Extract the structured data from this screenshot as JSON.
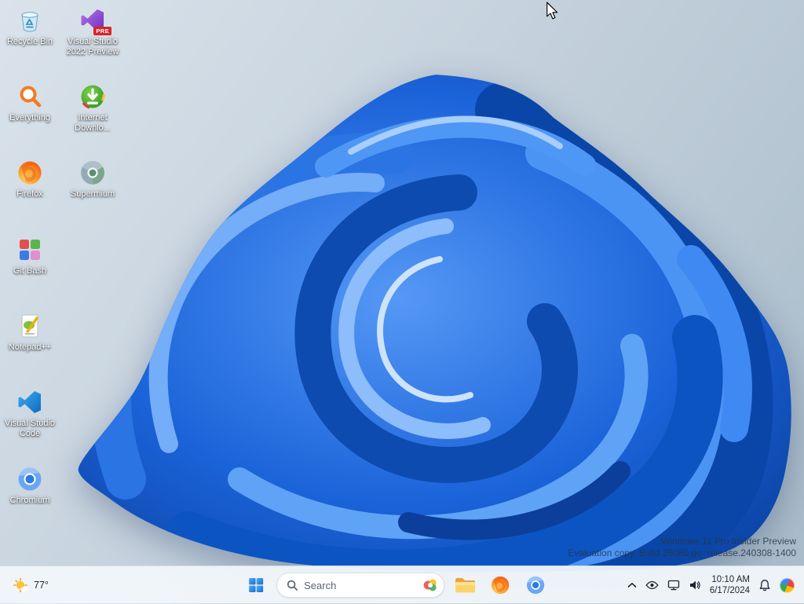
{
  "desktop": {
    "icons": {
      "recycle_bin": {
        "label": "Recycle Bin"
      },
      "vs2022": {
        "label": "Visual Studio 2022 Preview",
        "badge": "PRE"
      },
      "everything": {
        "label": "Everything"
      },
      "idm": {
        "label": "Internet Downlo..."
      },
      "firefox": {
        "label": "Firefox"
      },
      "supermium": {
        "label": "Supermium"
      },
      "gitbash": {
        "label": "Git Bash"
      },
      "notepadpp": {
        "label": "Notepad++"
      },
      "vscode": {
        "label": "Visual Studio Code"
      },
      "chromium": {
        "label": "Chromium"
      }
    },
    "watermark": {
      "line1": "Windows 11 Pro Insider Preview",
      "line2": "Evaluation copy. Build 26080.ge_release.240308-1400"
    }
  },
  "taskbar": {
    "weather": {
      "temp": "77°",
      "condition": "sunny"
    },
    "search": {
      "placeholder": "Search"
    },
    "apps": [
      "file-explorer",
      "firefox",
      "chromium"
    ],
    "clock": {
      "time": "10:10 AM",
      "date": "6/17/2024"
    }
  },
  "colors": {
    "accent_blue": "#1668e3",
    "taskbar_bg": "#f2f6fb",
    "badge_red": "#d9252a"
  }
}
